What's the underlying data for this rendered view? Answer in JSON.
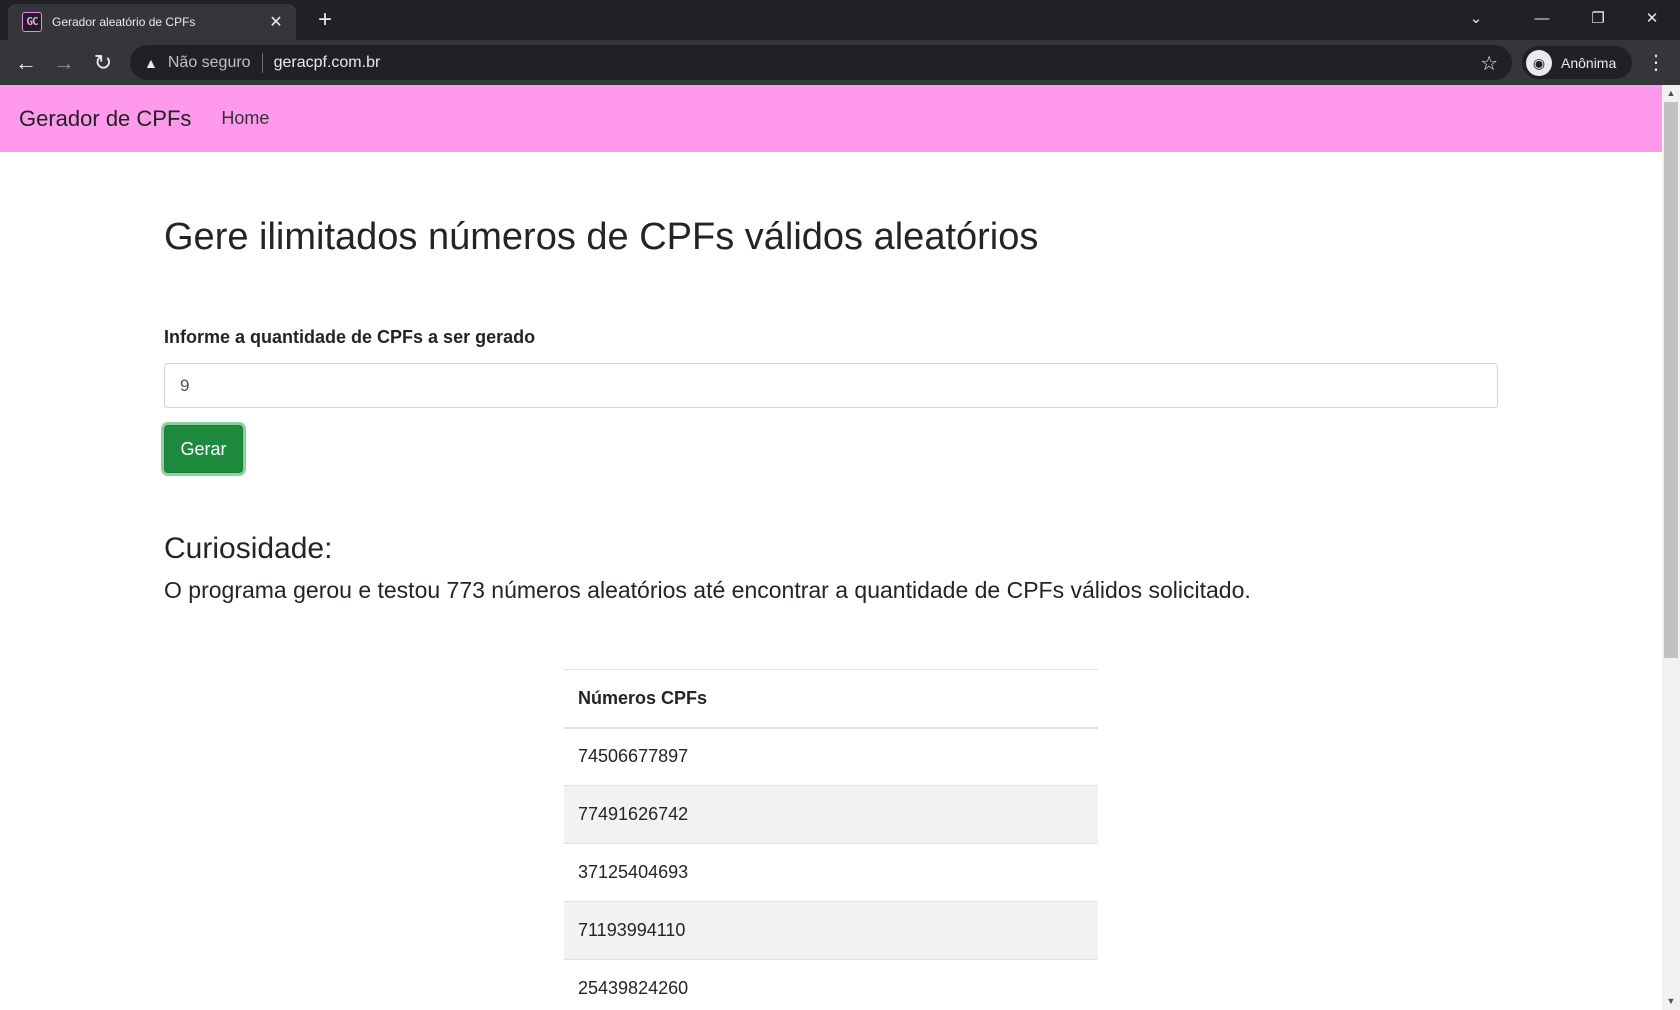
{
  "browser": {
    "tab_title": "Gerador aleatório de CPFs",
    "favicon_text": "GC",
    "security_label": "Não seguro",
    "url": "geracpf.com.br",
    "profile_label": "Anônima",
    "icons": {
      "new_tab": "+",
      "tab_search": "⌄",
      "minimize": "—",
      "restore": "❐",
      "close": "✕",
      "back": "←",
      "forward": "→",
      "reload": "↻",
      "warning": "▲",
      "star": "☆",
      "menu": "⋮",
      "incognito": "◉"
    }
  },
  "navbar": {
    "brand": "Gerador de CPFs",
    "links": [
      "Home"
    ],
    "color": "#ff99ec"
  },
  "main": {
    "title": "Gere ilimitados números de CPFs válidos aleatórios",
    "quantity_label": "Informe a quantidade de CPFs a ser gerado",
    "quantity_value": "9",
    "generate_button": "Gerar",
    "curiosity_title": "Curiosidade:",
    "curiosity_text": "O programa gerou e testou 773 números aleatórios até encontrar a quantidade de CPFs válidos solicitado.",
    "table": {
      "header": "Números CPFs",
      "rows": [
        "74506677897",
        "77491626742",
        "37125404693",
        "71193994110",
        "25439824260"
      ]
    }
  },
  "colors": {
    "button": "#1e8a3e",
    "navbar": "#ff99ec"
  }
}
